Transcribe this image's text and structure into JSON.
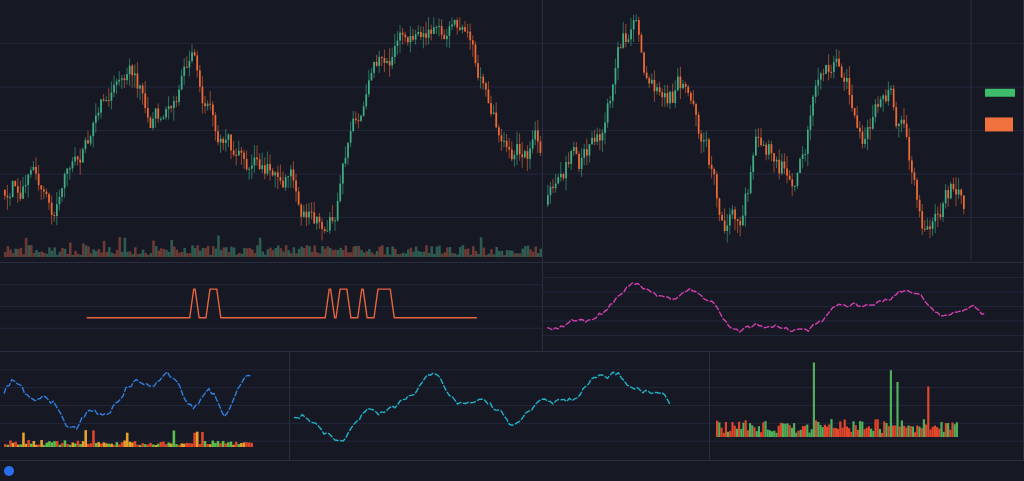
{
  "top_row": [
    {
      "kind": "candlestick"
    },
    {
      "kind": "candlestick"
    }
  ],
  "middle_row": [
    {
      "kind": "spikes",
      "color": "#e8643c"
    },
    {
      "kind": "line",
      "color": "#d23fae"
    }
  ],
  "bottom_row": [
    {
      "kind": "line_volume",
      "color": "#2f7fe0"
    },
    {
      "kind": "line",
      "color": "#1fb3c8"
    },
    {
      "kind": "volume"
    }
  ]
}
